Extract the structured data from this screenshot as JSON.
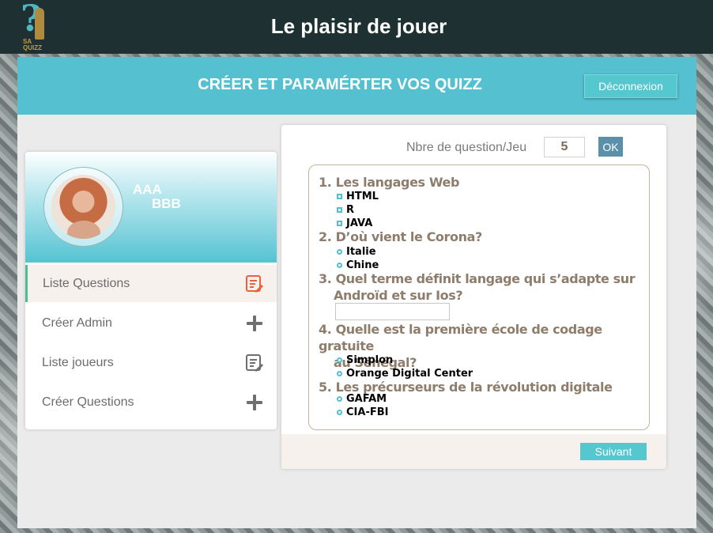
{
  "header": {
    "logo_text_top": "SA",
    "logo_text_bottom": "QUIZZ",
    "title": "Le plaisir de jouer"
  },
  "panel": {
    "title": "CRÉER ET PARAMÉRTER VOS QUIZZ",
    "logout_label": "Déconnexion"
  },
  "profile": {
    "first_name": "AAA",
    "last_name": "BBB"
  },
  "sidebar": {
    "items": [
      {
        "label": "Liste Questions",
        "icon": "edit-list-icon",
        "active": true
      },
      {
        "label": "Créer Admin",
        "icon": "plus-icon",
        "active": false
      },
      {
        "label": "Liste joueurs",
        "icon": "edit-list-icon",
        "active": false
      },
      {
        "label": "Créer Questions",
        "icon": "plus-icon",
        "active": false
      }
    ]
  },
  "quiz": {
    "nb_question_label": "Nbre de question/Jeu",
    "nb_question_value": "5",
    "ok_label": "OK",
    "questions": [
      {
        "title": "1. Les langages Web",
        "type": "checkbox",
        "options": [
          "HTML",
          "R",
          "JAVA"
        ]
      },
      {
        "title": "2. D’où vient le Corona?",
        "type": "radio",
        "options": [
          "Italie",
          "Chine"
        ]
      },
      {
        "title_line1": "3. Quel terme définit langage qui s’adapte sur",
        "title_line2": "Androïd et sur Ios?",
        "type": "text"
      },
      {
        "title_line1": "4. Quelle est la première école de codage gratuite",
        "title_line2": "au Sénégal?",
        "type": "radio",
        "options": [
          "Simplon",
          "Orange Digital Center"
        ]
      },
      {
        "title": "5. Les précurseurs de la révolution digitale",
        "type": "radio",
        "options": [
          "GAFAM",
          "CIA-FBI"
        ]
      }
    ],
    "next_label": "Suivant"
  },
  "colors": {
    "accent": "#54c0d0",
    "header_bg": "#1e3031",
    "question_text": "#8f7d6c",
    "active_indicator": "#4bbf8f",
    "icon_orange": "#e8633a"
  }
}
